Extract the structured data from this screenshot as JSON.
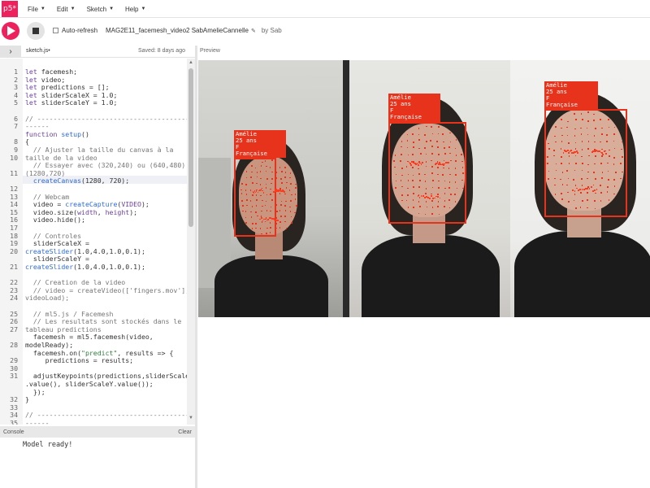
{
  "app": {
    "logo_text": "p5*",
    "menu": [
      {
        "label": "File"
      },
      {
        "label": "Edit"
      },
      {
        "label": "Sketch"
      },
      {
        "label": "Help"
      }
    ]
  },
  "toolbar": {
    "autorefresh_label": "Auto-refresh",
    "sketch_name": "MAG2E11_facemesh_video2 SabAmelieCannelle",
    "by_label": "by Sab"
  },
  "editor": {
    "file_tab": "sketch.js",
    "saved_text": "Saved: 8 days ago",
    "line_numbers": [
      "1",
      "2",
      "3",
      "4",
      "5",
      "",
      "6",
      "7",
      "",
      "8",
      "9",
      "10",
      "",
      "11",
      "",
      "12",
      "13",
      "14",
      "15",
      "16",
      "17",
      "18",
      "19",
      "20",
      "",
      "21",
      "",
      "22",
      "23",
      "24",
      "",
      "25",
      "26",
      "27",
      "",
      "28",
      "",
      "29",
      "30",
      "31",
      "",
      "",
      "32",
      "33",
      "34",
      "35",
      ""
    ]
  },
  "preview": {
    "label": "Preview",
    "panels": [
      {
        "lines": [
          "Amélie",
          "25 ans",
          "F",
          "Française"
        ]
      },
      {
        "lines": [
          "Amélie",
          "25 ans",
          "F",
          "Française"
        ]
      },
      {
        "lines": [
          "Amélie",
          "25 ans",
          "F",
          "Française"
        ]
      }
    ]
  },
  "console": {
    "title": "Console",
    "clear_label": "Clear",
    "message": "Model ready!"
  },
  "colors": {
    "accent": "#ed225d",
    "bbox": "#e8331c"
  }
}
